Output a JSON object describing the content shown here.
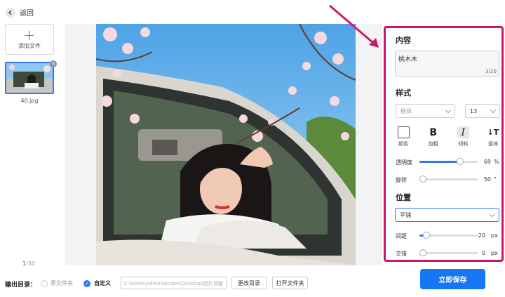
{
  "header": {
    "back_label": "返回"
  },
  "sidebar": {
    "add_file_label": "添加文件",
    "thumbnail_name": "40.jpg",
    "page_current": "1",
    "page_total": "/30"
  },
  "watermark": {
    "text": "桃木木"
  },
  "panel": {
    "content_title": "内容",
    "content_value": "桃木木",
    "content_count": "3/20",
    "style_title": "样式",
    "font_value": "楷体",
    "size_value": "13",
    "style_buttons": [
      {
        "glyph": "",
        "label": "颜色"
      },
      {
        "glyph": "B",
        "label": "加粗"
      },
      {
        "glyph": "I",
        "label": "倾斜"
      },
      {
        "glyph": "↓T",
        "label": "竖排"
      }
    ],
    "opacity_label": "透明度",
    "opacity_value": "69",
    "opacity_unit": "%",
    "rotate_label": "旋转",
    "rotate_value": "50",
    "rotate_unit": "°",
    "position_title": "位置",
    "position_value": "平铺",
    "spacing_label": "间距",
    "spacing_value": "20",
    "spacing_unit": "px",
    "stagger_label": "交错",
    "stagger_value": "0",
    "stagger_unit": "px"
  },
  "sliders": {
    "opacity": 0.69,
    "rotate": 0.06,
    "spacing": 0.12,
    "stagger": 0.0
  },
  "footer": {
    "output_label": "输出目录：",
    "option_original": "原文件夹",
    "option_custom": "自定义",
    "path_value": "C:\\Users\\Administrator\\Desktop\\图片调整",
    "change_dir": "更改目录",
    "open_folder": "打开文件夹",
    "save_button": "立即保存"
  },
  "colors": {
    "accent": "#1677f5",
    "highlight_border": "#c8166a",
    "annotation_arrow": "#d3176e"
  }
}
